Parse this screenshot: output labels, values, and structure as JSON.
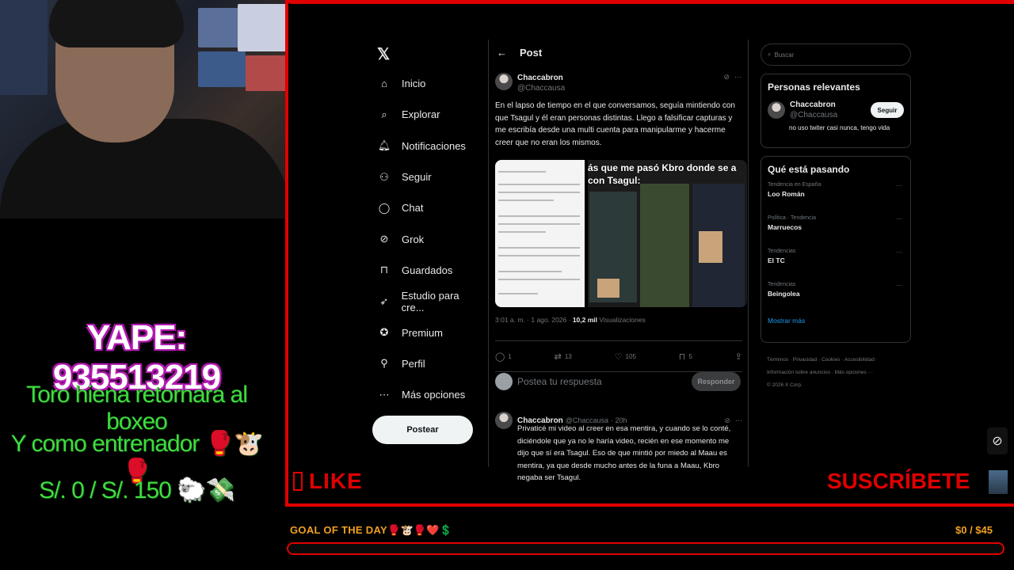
{
  "webcam": {},
  "twitter": {
    "nav": [
      {
        "label": "Inicio",
        "icon": "home-icon"
      },
      {
        "label": "Explorar",
        "icon": "search-icon"
      },
      {
        "label": "Notificaciones",
        "icon": "bell-icon"
      },
      {
        "label": "Seguir",
        "icon": "add-user-icon"
      },
      {
        "label": "Chat",
        "icon": "chat-icon"
      },
      {
        "label": "Grok",
        "icon": "grok-icon"
      },
      {
        "label": "Guardados",
        "icon": "bookmark-icon"
      },
      {
        "label": "Estudio para cre...",
        "icon": "rocket-icon"
      },
      {
        "label": "Premium",
        "icon": "verified-icon"
      },
      {
        "label": "Perfil",
        "icon": "person-icon"
      },
      {
        "label": "Más opciones",
        "icon": "more-circle-icon"
      }
    ],
    "post_button": "Postear",
    "header_title": "Post",
    "post": {
      "author_name": "Chaccabron",
      "author_handle": "@Chaccausa",
      "text": "En el lapso de tiempo en el que conversamos, seguía mintiendo con que Tsagul y él eran personas distintas. Llego a falsificar capturas y me escribía desde una multi cuenta para manipularme y hacerme creer que no eran los mismos.",
      "media_caption": "ás que me pasó Kbro donde se a con Tsagul:",
      "time": "3:01 a. m. · 1 ago. 2026 ·",
      "views_count": "10,2 mil",
      "views_label": "Visualizaciones",
      "replies": "1",
      "reposts": "13",
      "likes": "105",
      "bookmarks": "5"
    },
    "reply_placeholder": "Postea tu respuesta",
    "reply_button": "Responder",
    "reply_post": {
      "author_name": "Chaccabron",
      "author_handle": "@Chaccausa",
      "age": "· 20h",
      "text": "Privaticé mi video al creer en esa mentira, y cuando se lo conté, diciéndole que ya no le haría video, recién en ese momento me dijo que sí era Tsagul. Eso de que mintió por miedo al Maau es mentira, ya que desde mucho antes de la funa a Maau, Kbro negaba ser Tsagul."
    },
    "search_placeholder": "Buscar",
    "relevant": {
      "title": "Personas relevantes",
      "name": "Chaccabron",
      "handle": "@Chaccausa",
      "bio": "no uso twiter casi nunca, tengo vida",
      "follow": "Seguir"
    },
    "trending": {
      "title": "Qué está pasando",
      "items": [
        {
          "category": "Tendencia en España",
          "name": "Loo Román"
        },
        {
          "category": "Política · Tendencia",
          "name": "Marruecos"
        },
        {
          "category": "Tendencias",
          "name": "El TC"
        },
        {
          "category": "Tendencias",
          "name": "Beingolea"
        }
      ],
      "show_more": "Mostrar más"
    },
    "footer": {
      "line1": "Términos · Privacidad · Cookies · Accesibilidad ·",
      "line2": "Información sobre anuncios · Más opciones ···",
      "line3": "© 2026 X Corp."
    }
  },
  "overlay": {
    "yape": "YAPE: 935513219",
    "line1": "Toro hiena retornara al boxeo",
    "line2": "Y como entrenador 🥊🐮🥊",
    "line3": "S/. 0 / S/. 150  �without🐑💸",
    "like": "LIKE",
    "subscribe": "SUSCRÍBETE",
    "goal_label": "GOAL OF THE DAY🥊🐮🥊❤️💲",
    "goal_amount": "$0 / $45",
    "goal_progress": 0,
    "accent": "#e00000",
    "green": "#3fdc3f",
    "gold": "#f0a020"
  }
}
